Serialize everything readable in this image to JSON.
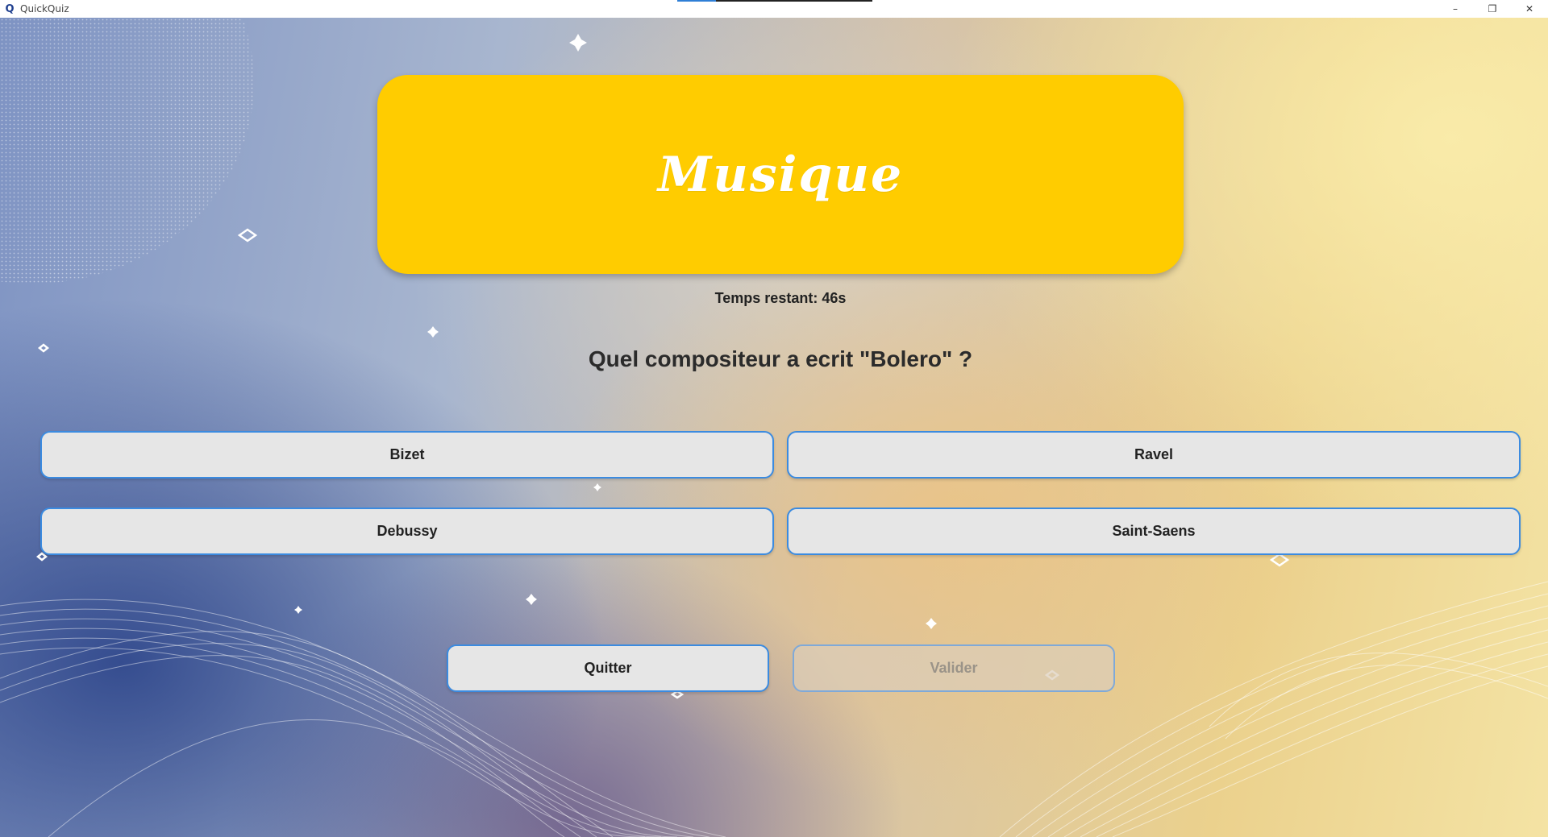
{
  "window": {
    "title": "QuickQuiz",
    "app_icon": "Q",
    "controls": {
      "minimize": "–",
      "restore": "❐",
      "close": "✕"
    },
    "progress": 0.2
  },
  "quiz": {
    "category": "Musique",
    "timer_text": "Temps restant: 46s",
    "question": "Quel compositeur a ecrit \"Bolero\" ?",
    "answers": [
      "Bizet",
      "Ravel",
      "Debussy",
      "Saint-Saens"
    ],
    "actions": {
      "quit": "Quitter",
      "validate": "Valider"
    }
  },
  "colors": {
    "banner": "#ffcc00",
    "button_border": "#3b8be0",
    "button_bg": "#e6e6e6"
  }
}
